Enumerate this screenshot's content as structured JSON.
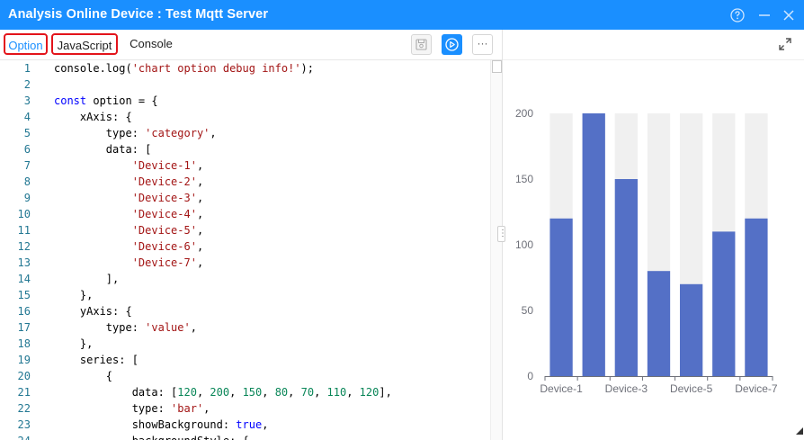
{
  "window": {
    "title": "Analysis Online Device : Test Mqtt Server"
  },
  "tabs": [
    {
      "label": "Option",
      "active": true
    },
    {
      "label": "JavaScript",
      "active": false
    },
    {
      "label": "Console",
      "active": false
    }
  ],
  "toolbar": {
    "save_icon": "save-icon",
    "run_icon": "play-icon",
    "more_label": "···"
  },
  "splitter_label": "⋮",
  "code_lines": [
    "<span>console.log(</span><span class=\"s\">'chart option debug info!'</span><span>);</span>",
    "",
    "<span class=\"k\">const</span><span> option = {</span>",
    "<span>    xAxis: {</span>",
    "<span>        type: </span><span class=\"s\">'category'</span><span>,</span>",
    "<span>        data: [</span>",
    "<span>            </span><span class=\"s\">'Device-1'</span><span>,</span>",
    "<span>            </span><span class=\"s\">'Device-2'</span><span>,</span>",
    "<span>            </span><span class=\"s\">'Device-3'</span><span>,</span>",
    "<span>            </span><span class=\"s\">'Device-4'</span><span>,</span>",
    "<span>            </span><span class=\"s\">'Device-5'</span><span>,</span>",
    "<span>            </span><span class=\"s\">'Device-6'</span><span>,</span>",
    "<span>            </span><span class=\"s\">'Device-7'</span><span>,</span>",
    "<span>        ],</span>",
    "<span>    },</span>",
    "<span>    yAxis: {</span>",
    "<span>        type: </span><span class=\"s\">'value'</span><span>,</span>",
    "<span>    },</span>",
    "<span>    series: [</span>",
    "<span>        {</span>",
    "<span>            data: [</span><span class=\"n\">120</span><span>, </span><span class=\"n\">200</span><span>, </span><span class=\"n\">150</span><span>, </span><span class=\"n\">80</span><span>, </span><span class=\"n\">70</span><span>, </span><span class=\"n\">110</span><span>, </span><span class=\"n\">120</span><span>],</span>",
    "<span>            type: </span><span class=\"s\">'bar'</span><span>,</span>",
    "<span>            showBackground: </span><span class=\"k\">true</span><span>,</span>",
    "<span>            backgroundStyle: {</span>"
  ],
  "code_text": [
    "console.log('chart option debug info!');",
    "",
    "const option = {",
    "    xAxis: {",
    "        type: 'category',",
    "        data: [",
    "            'Device-1',",
    "            'Device-2',",
    "            'Device-3',",
    "            'Device-4',",
    "            'Device-5',",
    "            'Device-6',",
    "            'Device-7',",
    "        ],",
    "    },",
    "    yAxis: {",
    "        type: 'value',",
    "    },",
    "    series: [",
    "        {",
    "            data: [120, 200, 150, 80, 70, 110, 120],",
    "            type: 'bar',",
    "            showBackground: true,",
    "            backgroundStyle: {"
  ],
  "line_numbers": [
    "1",
    "2",
    "3",
    "4",
    "5",
    "6",
    "7",
    "8",
    "9",
    "10",
    "11",
    "12",
    "13",
    "14",
    "15",
    "16",
    "17",
    "18",
    "19",
    "20",
    "21",
    "22",
    "23",
    "24"
  ],
  "colors": {
    "accent": "#1a8fff",
    "bar": "#5470c6",
    "bar_background": "#f0f0f0",
    "highlight_border": "#e3141b"
  },
  "chart_data": {
    "type": "bar",
    "categories": [
      "Device-1",
      "Device-2",
      "Device-3",
      "Device-4",
      "Device-5",
      "Device-6",
      "Device-7"
    ],
    "values": [
      120,
      200,
      150,
      80,
      70,
      110,
      120
    ],
    "ylim": [
      0,
      200
    ],
    "yticks": [
      0,
      50,
      100,
      150,
      200
    ],
    "xtick_labels_shown": [
      "Device-1",
      "Device-3",
      "Device-5",
      "Device-7"
    ],
    "show_background": true,
    "grid": false
  }
}
